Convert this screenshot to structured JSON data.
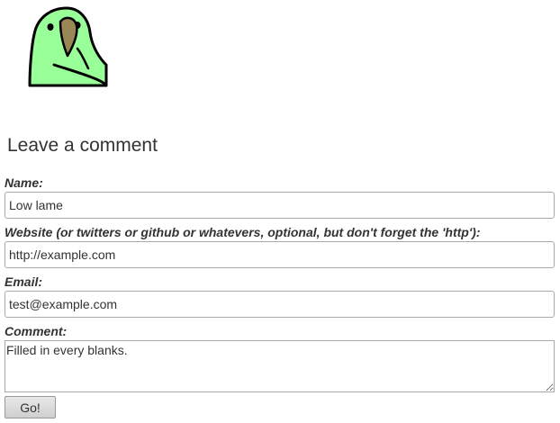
{
  "logo": {
    "icon": "parrot-icon",
    "colors": {
      "body": "#99ff99",
      "beak": "#998855",
      "outline": "#000000"
    }
  },
  "heading": "Leave a comment",
  "form": {
    "name": {
      "label": "Name:",
      "value": "Low lame"
    },
    "website": {
      "label": "Website (or twitters or github or whatevers, optional, but don't forget the 'http'):",
      "value": "http://example.com"
    },
    "email": {
      "label": "Email:",
      "value": "test@example.com"
    },
    "comment": {
      "label": "Comment:",
      "value": "Filled in every blanks."
    },
    "submit_label": "Go!"
  }
}
